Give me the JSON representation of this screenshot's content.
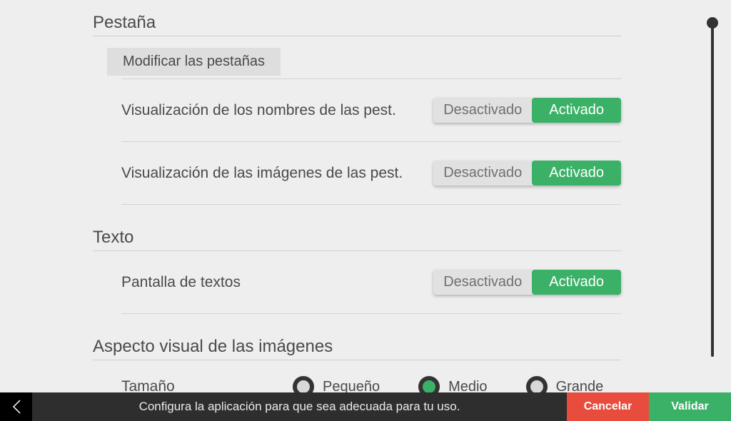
{
  "sections": {
    "tab": {
      "title": "Pestaña",
      "modify_label": "Modificar las pestañas",
      "row_names": {
        "label": "Visualización de los nombres de  las pest.",
        "off": "Desactivado",
        "on": "Activado"
      },
      "row_images": {
        "label": "Visualización de las imágenes de las pest.",
        "off": "Desactivado",
        "on": "Activado"
      }
    },
    "text": {
      "title": "Texto",
      "row_screen": {
        "label": "Pantalla de textos",
        "off": "Desactivado",
        "on": "Activado"
      }
    },
    "images": {
      "title": "Aspecto visual de las imágenes",
      "size_label": "Tamaño",
      "options": {
        "small": "Pequeño",
        "medium": "Medio",
        "large": "Grande"
      }
    }
  },
  "bottombar": {
    "hint": "Configura la aplicación para que sea adecuada para tu uso.",
    "cancel": "Cancelar",
    "validate": "Validar"
  }
}
